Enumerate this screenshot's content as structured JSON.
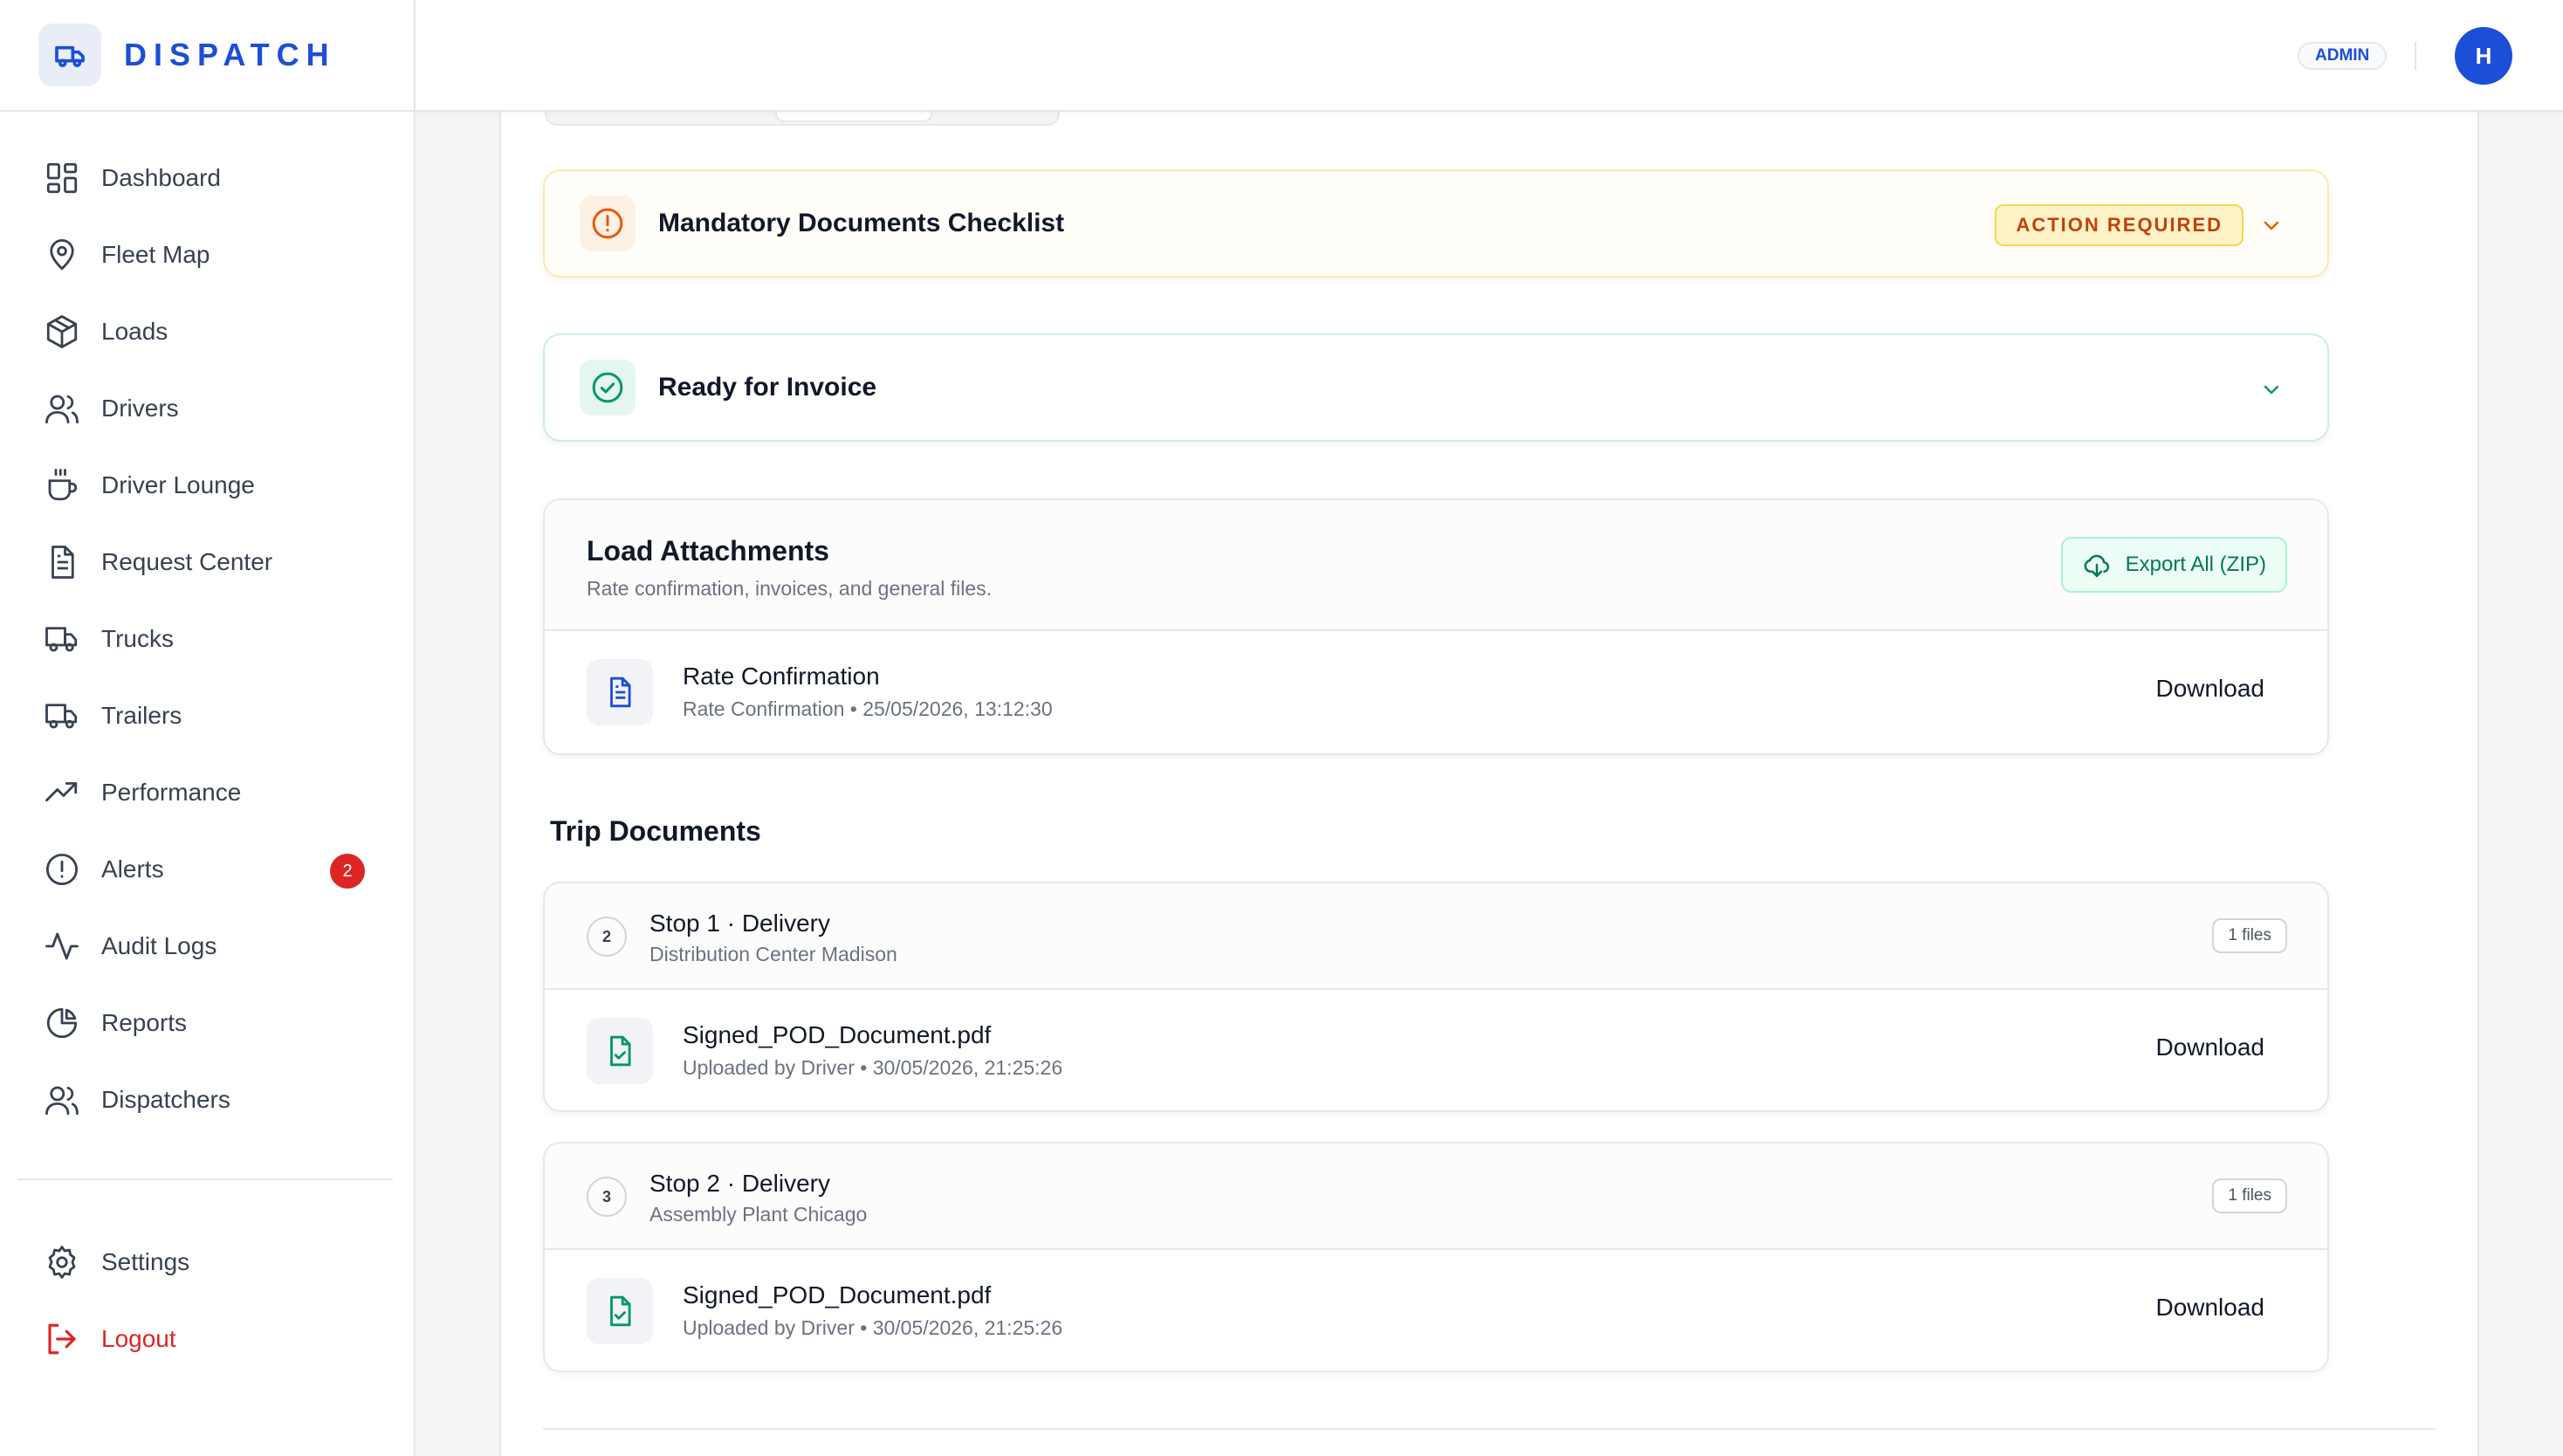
{
  "brand": {
    "name": "DISPATCH"
  },
  "sidebar": {
    "items": [
      {
        "label": "Dashboard",
        "icon": "dashboard-icon"
      },
      {
        "label": "Fleet Map",
        "icon": "map-pin-icon"
      },
      {
        "label": "Loads",
        "icon": "package-icon"
      },
      {
        "label": "Drivers",
        "icon": "users-icon"
      },
      {
        "label": "Driver Lounge",
        "icon": "coffee-icon"
      },
      {
        "label": "Request Center",
        "icon": "document-icon"
      },
      {
        "label": "Trucks",
        "icon": "truck-icon"
      },
      {
        "label": "Trailers",
        "icon": "truck-icon"
      },
      {
        "label": "Performance",
        "icon": "trending-up-icon"
      },
      {
        "label": "Alerts",
        "icon": "alert-circle-icon",
        "badge": "2"
      },
      {
        "label": "Audit Logs",
        "icon": "activity-icon"
      },
      {
        "label": "Reports",
        "icon": "pie-chart-icon"
      },
      {
        "label": "Dispatchers",
        "icon": "users-icon"
      }
    ],
    "bottom": [
      {
        "label": "Settings",
        "icon": "gear-icon"
      },
      {
        "label": "Logout",
        "icon": "logout-icon"
      }
    ]
  },
  "topbar": {
    "role": "ADMIN",
    "avatar_initial": "H"
  },
  "checklist": {
    "title": "Mandatory Documents Checklist",
    "status": "ACTION REQUIRED",
    "status_color": "#c2410c"
  },
  "invoice": {
    "title": "Ready for Invoice",
    "color": "#059669"
  },
  "attachments": {
    "title": "Load Attachments",
    "subtitle": "Rate confirmation, invoices, and general files.",
    "export_label": "Export All (ZIP)",
    "files": [
      {
        "name": "Rate Confirmation",
        "meta": "Rate Confirmation • 25/05/2026, 13:12:30",
        "action": "Download"
      }
    ]
  },
  "trip_documents": {
    "title": "Trip Documents",
    "stops": [
      {
        "number": "2",
        "title": "Stop 1 · Delivery",
        "location": "Distribution Center Madison",
        "file_count": "1 files",
        "files": [
          {
            "name": "Signed_POD_Document.pdf",
            "meta": "Uploaded by Driver • 30/05/2026, 21:25:26",
            "action": "Download"
          }
        ]
      },
      {
        "number": "3",
        "title": "Stop 2 · Delivery",
        "location": "Assembly Plant Chicago",
        "file_count": "1 files",
        "files": [
          {
            "name": "Signed_POD_Document.pdf",
            "meta": "Uploaded by Driver • 30/05/2026, 21:25:26",
            "action": "Download"
          }
        ]
      }
    ]
  },
  "colors": {
    "brand": "#1d4ed8",
    "danger": "#dc2626",
    "success": "#059669",
    "warning": "#ea580c"
  }
}
